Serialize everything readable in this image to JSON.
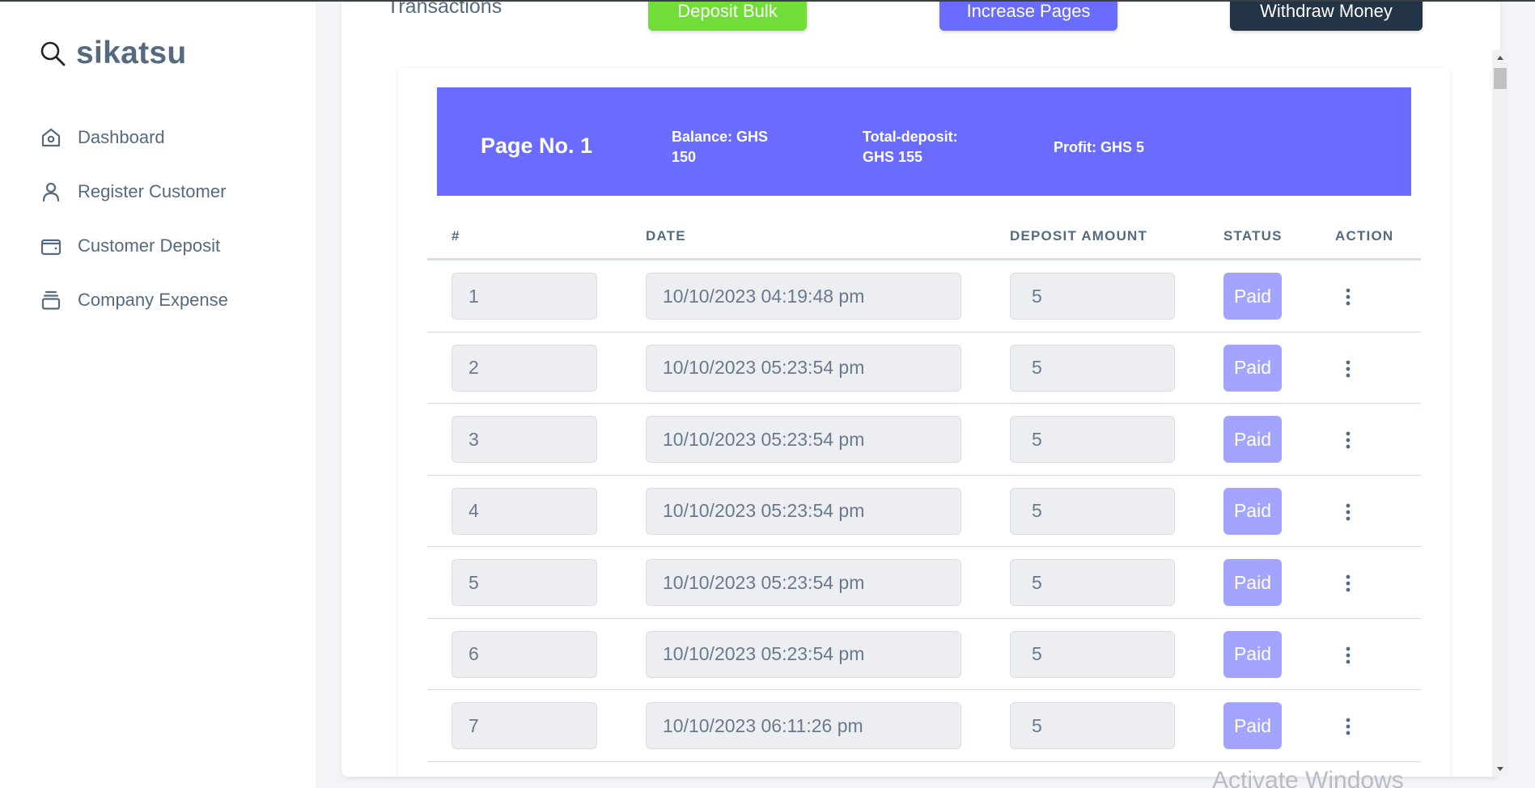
{
  "app": {
    "brand_name": "sikatsu"
  },
  "sidebar": {
    "items": [
      {
        "label": "Dashboard",
        "icon": "home-icon"
      },
      {
        "label": "Register Customer",
        "icon": "user-icon"
      },
      {
        "label": "Customer Deposit",
        "icon": "wallet-icon"
      },
      {
        "label": "Company Expense",
        "icon": "layers-icon"
      }
    ]
  },
  "header": {
    "title": "Transactions",
    "buttons": {
      "deposit_bulk": "Deposit Bulk",
      "increase_pages": "Increase Pages",
      "withdraw_money": "Withdraw Money"
    }
  },
  "page_banner": {
    "page_no": "Page No. 1",
    "balance": "Balance: GHS 150",
    "total_deposit": "Total-deposit: GHS 155",
    "profit": "Profit: GHS 5"
  },
  "table": {
    "columns": [
      "#",
      "DATE",
      "DEPOSIT AMOUNT",
      "STATUS",
      "ACTION"
    ],
    "rows": [
      {
        "num": "1",
        "date": "10/10/2023 04:19:48 pm",
        "amount": "5",
        "status": "Paid"
      },
      {
        "num": "2",
        "date": "10/10/2023 05:23:54 pm",
        "amount": "5",
        "status": "Paid"
      },
      {
        "num": "3",
        "date": "10/10/2023 05:23:54 pm",
        "amount": "5",
        "status": "Paid"
      },
      {
        "num": "4",
        "date": "10/10/2023 05:23:54 pm",
        "amount": "5",
        "status": "Paid"
      },
      {
        "num": "5",
        "date": "10/10/2023 05:23:54 pm",
        "amount": "5",
        "status": "Paid"
      },
      {
        "num": "6",
        "date": "10/10/2023 05:23:54 pm",
        "amount": "5",
        "status": "Paid"
      },
      {
        "num": "7",
        "date": "10/10/2023 06:11:26 pm",
        "amount": "5",
        "status": "Paid"
      }
    ]
  },
  "colors": {
    "primary": "#696cff",
    "success": "#71dd37",
    "dark": "#233446",
    "badge_paid": "#a3a4ff",
    "text": "#566a7f"
  },
  "watermark": "Activate Windows"
}
